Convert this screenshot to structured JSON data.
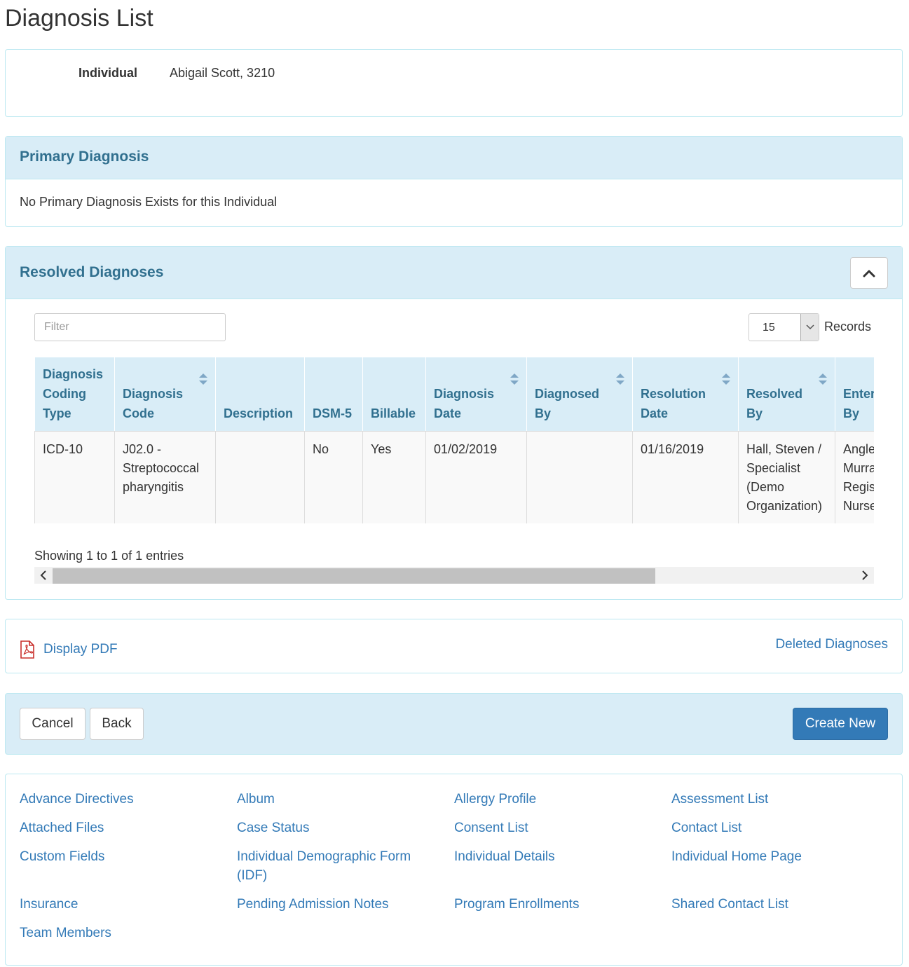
{
  "page": {
    "title": "Diagnosis List"
  },
  "individual": {
    "label": "Individual",
    "value": "Abigail Scott, 3210"
  },
  "primary": {
    "heading": "Primary Diagnosis",
    "message": "No Primary Diagnosis Exists for this Individual"
  },
  "resolved": {
    "heading": "Resolved Diagnoses",
    "filter_placeholder": "Filter",
    "records_value": "15",
    "records_label": "Records",
    "columns": [
      [
        "Diagnosis",
        "Coding",
        "Type"
      ],
      [
        "Diagnosis",
        "Code"
      ],
      [
        "Description"
      ],
      [
        "DSM-5"
      ],
      [
        "Billable"
      ],
      [
        "Diagnosis",
        "Date"
      ],
      [
        "Diagnosed",
        "By"
      ],
      [
        "Resolution",
        "Date"
      ],
      [
        "Resolved",
        "By"
      ],
      [
        "Entered",
        "By"
      ]
    ],
    "rows": [
      {
        "cells": [
          [
            "ICD-10"
          ],
          [
            "J02.0 -",
            "Streptococcal",
            "pharyngitis"
          ],
          [],
          [
            "No"
          ],
          [
            "Yes"
          ],
          [
            "01/02/2019"
          ],
          [],
          [
            "01/16/2019"
          ],
          [
            "Hall, Steven /",
            "Specialist",
            "(Demo",
            "Organization)"
          ],
          [
            "Angle",
            "Murra",
            "Regis",
            "Nurse"
          ]
        ]
      }
    ],
    "showing": "Showing 1 to 1 of 1 entries"
  },
  "links": {
    "display_pdf": "Display PDF",
    "deleted": "Deleted Diagnoses"
  },
  "actions": {
    "cancel": "Cancel",
    "back": "Back",
    "create": "Create New"
  },
  "nav": [
    "Advance Directives",
    "Album",
    "Allergy Profile",
    "Assessment List",
    "Attached Files",
    "Case Status",
    "Consent List",
    "Contact List",
    "Custom Fields",
    "Individual Demographic Form (IDF)",
    "Individual Details",
    "Individual Home Page",
    "Insurance",
    "Pending Admission Notes",
    "Program Enrollments",
    "Shared Contact List",
    "Team Members"
  ],
  "colors": {
    "accent": "#337ab7",
    "panel_bg": "#d9edf7",
    "panel_text": "#31708f",
    "pdf_red": "#c9302c"
  }
}
